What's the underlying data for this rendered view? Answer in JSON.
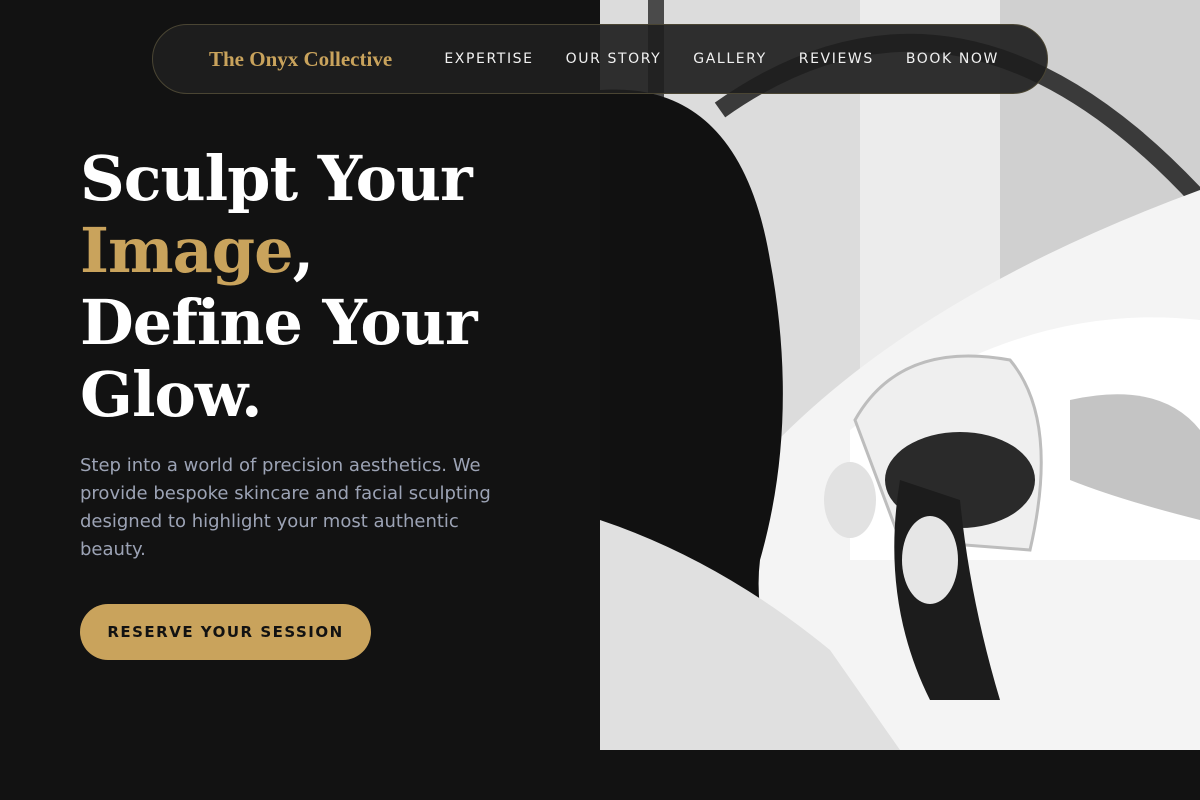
{
  "nav": {
    "logo": "The Onyx Collective",
    "links": [
      {
        "label": "EXPERTISE"
      },
      {
        "label": "OUR STORY"
      },
      {
        "label": "GALLERY"
      },
      {
        "label": "REVIEWS"
      },
      {
        "label": "BOOK NOW"
      }
    ]
  },
  "hero": {
    "headline_line1": "Sculpt Your",
    "headline_accent": "Image",
    "headline_comma": ",",
    "headline_line3": "Define Your",
    "headline_line4": "Glow.",
    "intro": "Step into a world of precision aesthetics. We provide bespoke skincare and facial sculpting designed to highlight your most authentic beauty.",
    "cta_label": "RESERVE YOUR SESSION"
  },
  "colors": {
    "background": "#121212",
    "accent": "#c9a35c",
    "body_text": "#9ca3b5"
  }
}
